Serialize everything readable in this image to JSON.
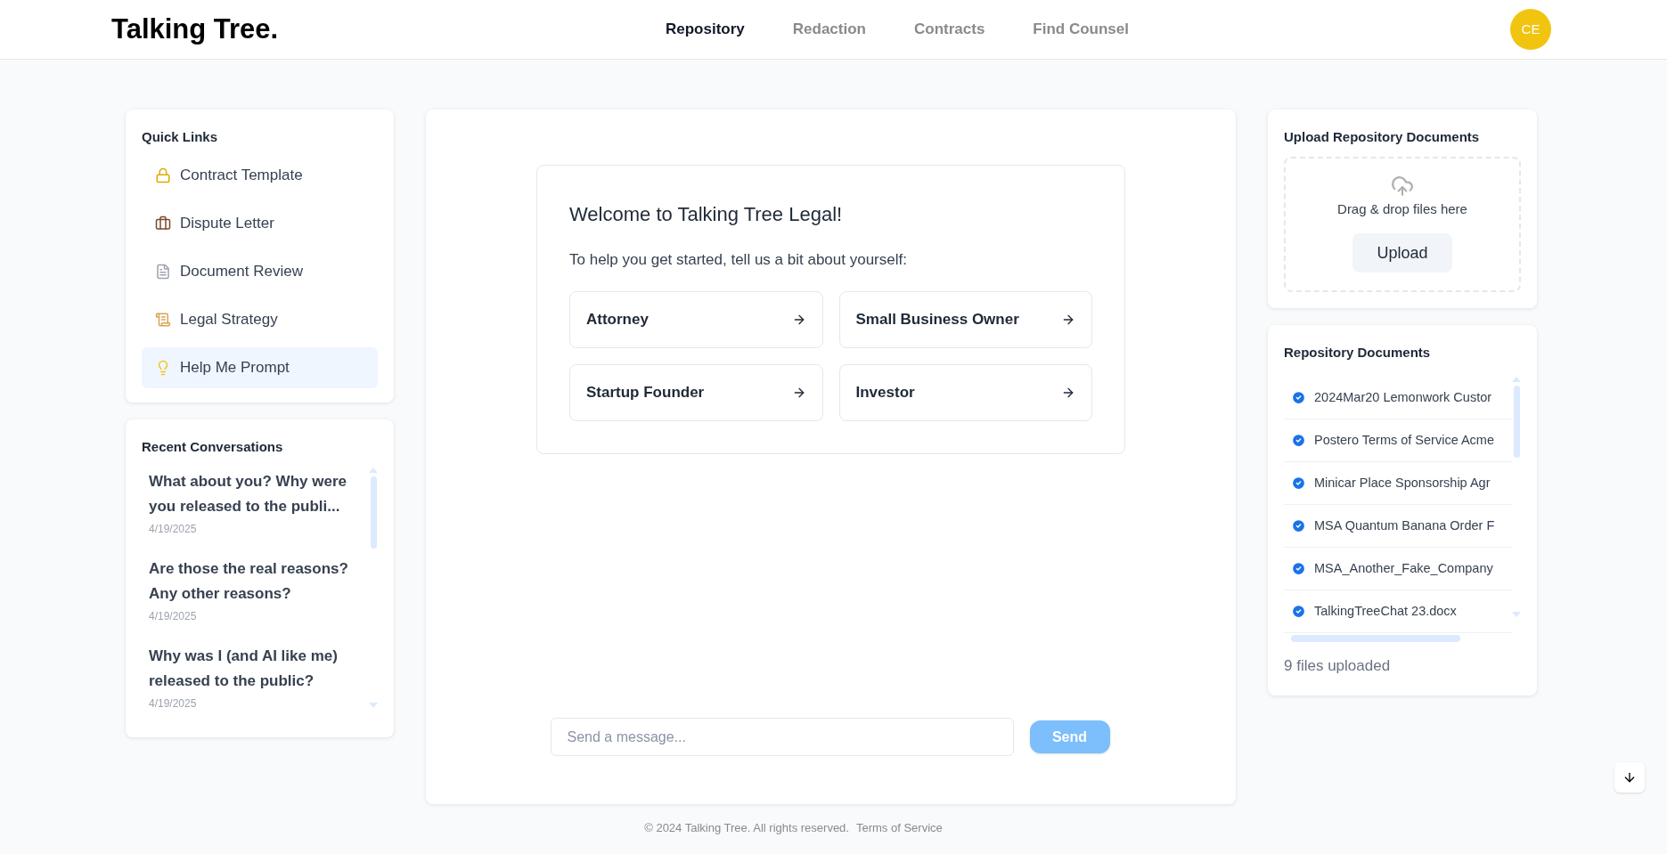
{
  "header": {
    "logo": "Talking Tree.",
    "nav": [
      {
        "label": "Repository",
        "selected": true
      },
      {
        "label": "Redaction",
        "selected": false
      },
      {
        "label": "Contracts",
        "selected": false
      },
      {
        "label": "Find Counsel",
        "selected": false
      }
    ],
    "avatar": "CE"
  },
  "quick_links": {
    "title": "Quick Links",
    "items": [
      {
        "kind": "lock",
        "label": "Contract Template",
        "selected": false
      },
      {
        "kind": "briefcase",
        "label": "Dispute Letter",
        "selected": false
      },
      {
        "kind": "document",
        "label": "Document Review",
        "selected": false
      },
      {
        "kind": "scroll",
        "label": "Legal Strategy",
        "selected": false
      },
      {
        "kind": "bulb",
        "label": "Help Me Prompt",
        "selected": true
      }
    ]
  },
  "recent_conversations": {
    "title": "Recent Conversations",
    "items": [
      {
        "title": "What about you? Why were you released to the publi...",
        "date": "4/19/2025"
      },
      {
        "title": "Are those the real reasons? Any other reasons?",
        "date": "4/19/2025"
      },
      {
        "title": "Why was I (and AI like me) released to the public?",
        "date": "4/19/2025"
      }
    ]
  },
  "welcome": {
    "title": "Welcome to Talking Tree Legal!",
    "prompt": "To help you get started, tell us a bit about yourself:",
    "options": [
      "Attorney",
      "Small Business Owner",
      "Startup Founder",
      "Investor"
    ]
  },
  "composer": {
    "placeholder": "Send a message...",
    "send": "Send"
  },
  "upload": {
    "title": "Upload Repository Documents",
    "hint": "Drag & drop files here",
    "button": "Upload"
  },
  "repository": {
    "title": "Repository Documents",
    "files": [
      {
        "name": "2024Mar20 Lemonwork Custor",
        "checked": true
      },
      {
        "name": "Postero Terms of Service Acme",
        "checked": true
      },
      {
        "name": "Minicar Place Sponsorship Agr",
        "checked": true
      },
      {
        "name": "MSA Quantum Banana Order F",
        "checked": true
      },
      {
        "name": "MSA_Another_Fake_Company",
        "checked": true
      },
      {
        "name": "TalkingTreeChat 23.docx",
        "checked": true
      }
    ],
    "count": "9 files uploaded"
  },
  "footer": {
    "copyright": "© 2024 Talking Tree. All rights reserved.",
    "link": "Terms of Service"
  }
}
